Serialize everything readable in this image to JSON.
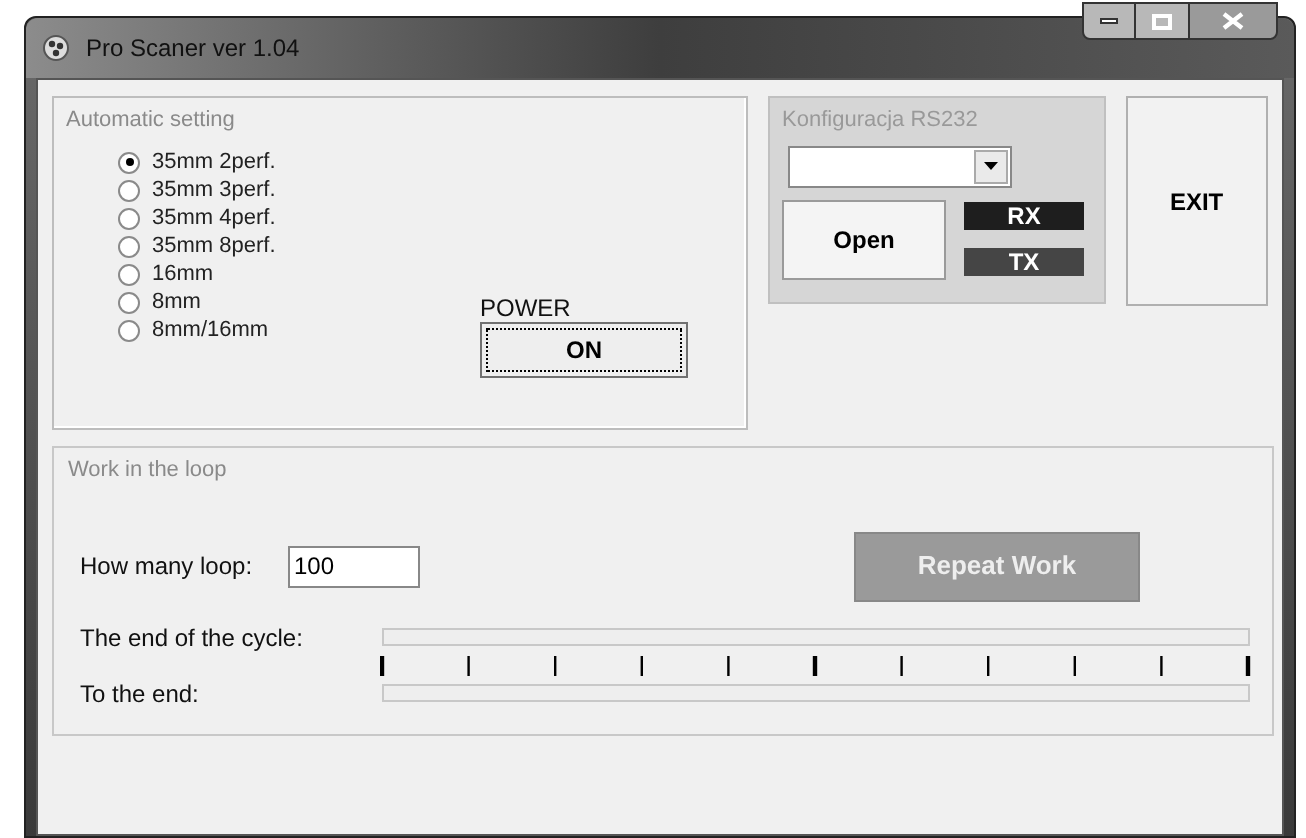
{
  "window": {
    "title": "Pro Scaner ver 1.04"
  },
  "automatic_setting": {
    "title": "Automatic setting",
    "options": [
      {
        "label": "35mm 2perf.",
        "selected": true
      },
      {
        "label": "35mm 3perf.",
        "selected": false
      },
      {
        "label": "35mm 4perf.",
        "selected": false
      },
      {
        "label": "35mm 8perf.",
        "selected": false
      },
      {
        "label": "16mm",
        "selected": false
      },
      {
        "label": "8mm",
        "selected": false
      },
      {
        "label": "8mm/16mm",
        "selected": false
      }
    ],
    "power_label": "POWER",
    "power_button": "ON"
  },
  "rs232": {
    "title": "Konfiguracja RS232",
    "open_button": "Open",
    "indicators": [
      {
        "label": "RX",
        "color": "#1e1e1e"
      },
      {
        "label": "TX",
        "color": "#454545"
      }
    ]
  },
  "exit_button": "EXIT",
  "loop": {
    "title": "Work in the loop",
    "count_label": "How many loop:",
    "count_value": "100",
    "repeat_button": {
      "label": "Repeat Work",
      "disabled": true
    },
    "progress": [
      {
        "label": "The end of the cycle:",
        "level": 0
      },
      {
        "label": "To the end:",
        "level": 0
      }
    ]
  }
}
